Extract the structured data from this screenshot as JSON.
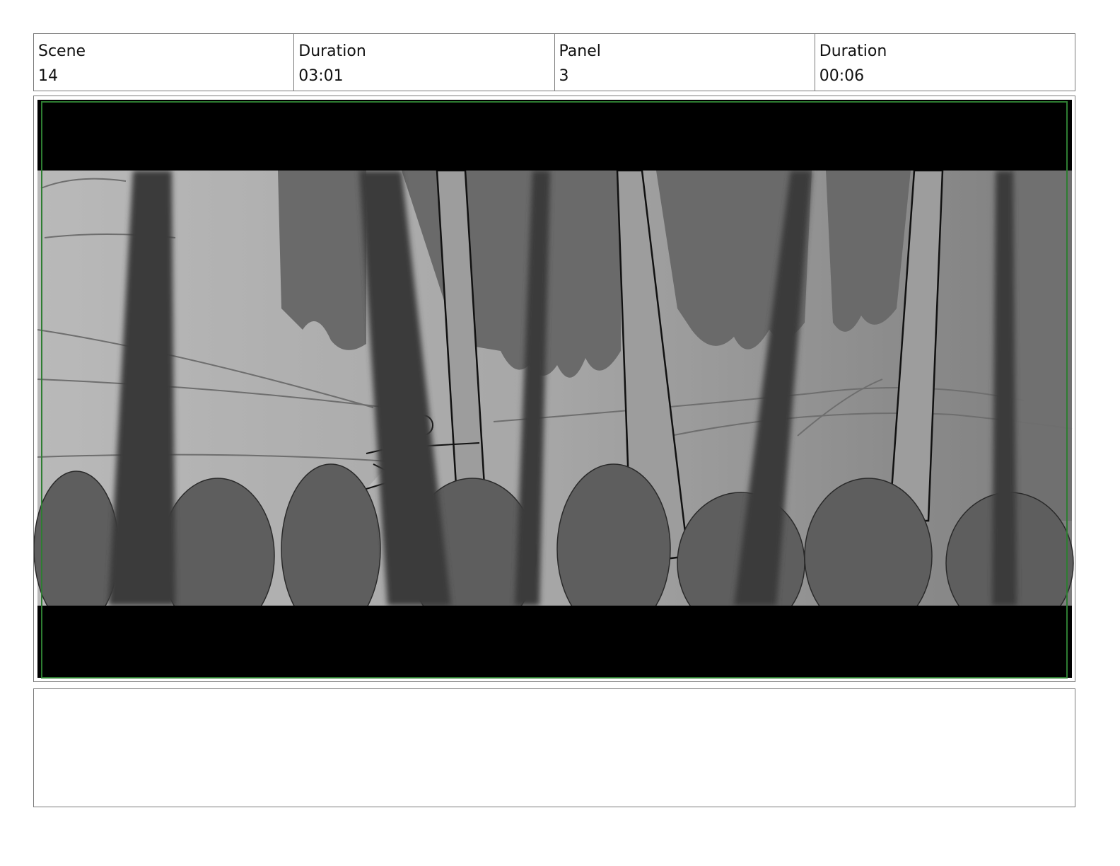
{
  "header": {
    "scene_label": "Scene",
    "scene_value": "14",
    "scene_duration_label": "Duration",
    "scene_duration_value": "03:01",
    "panel_label": "Panel",
    "panel_value": "3",
    "panel_duration_label": "Duration",
    "panel_duration_value": "00:06"
  },
  "panel_image": {
    "description_icon": "storyboard-sketch-forest-chase",
    "safe_frame_color": "#2e7d32",
    "letterbox_color": "#000000"
  },
  "notes": {
    "text": ""
  }
}
